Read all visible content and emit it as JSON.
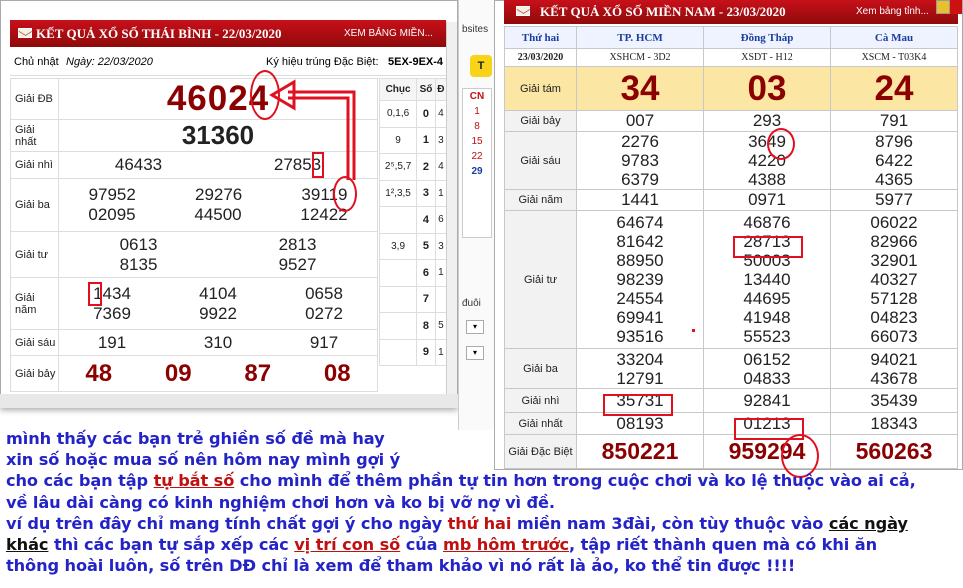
{
  "left_panel": {
    "title": "KẾT QUẢ XỔ SỐ THÁI BÌNH - 22/03/2020",
    "more_link": "XEM BẢNG MIỀN...",
    "day": "Chủ nhật",
    "date": "Ngày: 22/03/2020",
    "code_label": "Ký hiệu trúng Đặc Biệt:",
    "code_value": "5EX-9EX-4",
    "prizes": {
      "db": {
        "label": "Giải ĐB",
        "numbers": [
          "46024"
        ]
      },
      "nhat": {
        "label": "Giải nhất",
        "numbers": [
          "31360"
        ]
      },
      "nhi": {
        "label": "Giải nhì",
        "numbers": [
          "46433",
          "27853"
        ]
      },
      "ba": {
        "label": "Giải ba",
        "numbers": [
          "97952",
          "29276",
          "39119",
          "02095",
          "44500",
          "12422"
        ]
      },
      "tu": {
        "label": "Giải tư",
        "numbers": [
          "0613",
          "2813",
          "8135",
          "9527"
        ]
      },
      "nam": {
        "label": "Giải năm",
        "numbers": [
          "1434",
          "4104",
          "0658",
          "7369",
          "9922",
          "0272"
        ]
      },
      "sau": {
        "label": "Giải sáu",
        "numbers": [
          "191",
          "310",
          "917"
        ]
      },
      "bay": {
        "label": "Giải bảy",
        "numbers": [
          "48",
          "09",
          "87",
          "08"
        ]
      }
    },
    "side_table": {
      "headers": [
        "Chục",
        "Số",
        "Đ"
      ],
      "rows": [
        [
          "0,1,6",
          "0",
          "4"
        ],
        [
          "9",
          "1",
          "3"
        ],
        [
          "2⁵,5,7",
          "2",
          "4"
        ],
        [
          "1²,3,5",
          "3",
          "1"
        ],
        [
          "",
          "4",
          "6"
        ],
        [
          "3,9",
          "5",
          "3"
        ],
        [
          "",
          "6",
          "1"
        ],
        [
          "",
          "7",
          ""
        ],
        [
          "",
          "8",
          "5"
        ],
        [
          "",
          "9",
          "1"
        ]
      ]
    }
  },
  "middle": {
    "site_text": "bsites",
    "button_label": "T",
    "calendar": [
      "CN",
      "1",
      "8",
      "15",
      "22",
      "29"
    ],
    "duoi_label": "đuôi"
  },
  "right_panel": {
    "title": "KẾT QUẢ XỔ SỐ MIỀN NAM - 23/03/2020",
    "more_link": "Xem bảng tỉnh...",
    "day": "Thứ hai",
    "date": "23/03/2020",
    "provinces": [
      "TP. HCM",
      "Đồng Tháp",
      "Cà Mau"
    ],
    "codes": [
      "XSHCM - 3D2",
      "XSDT - H12",
      "XSCM - T03K4"
    ],
    "prizes": [
      {
        "label": "Giải tám",
        "values": [
          [
            "34"
          ],
          [
            "03"
          ],
          [
            "24"
          ]
        ]
      },
      {
        "label": "Giải bảy",
        "values": [
          [
            "007"
          ],
          [
            "293"
          ],
          [
            "791"
          ]
        ]
      },
      {
        "label": "Giải sáu",
        "values": [
          [
            "2276",
            "9783",
            "6379"
          ],
          [
            "3649",
            "4220",
            "4388"
          ],
          [
            "8796",
            "6422",
            "4365"
          ]
        ]
      },
      {
        "label": "Giải năm",
        "values": [
          [
            "1441"
          ],
          [
            "0971"
          ],
          [
            "5977"
          ]
        ]
      },
      {
        "label": "Giải tư",
        "values": [
          [
            "64674",
            "81642",
            "88950",
            "98239",
            "24554",
            "69941",
            "93516"
          ],
          [
            "46876",
            "28713",
            "50003",
            "13440",
            "44695",
            "41948",
            "55523"
          ],
          [
            "06022",
            "82966",
            "32901",
            "40327",
            "57128",
            "04823",
            "66073"
          ]
        ]
      },
      {
        "label": "Giải ba",
        "values": [
          [
            "33204",
            "12791"
          ],
          [
            "06152",
            "04833"
          ],
          [
            "94021",
            "43678"
          ]
        ]
      },
      {
        "label": "Giải nhì",
        "values": [
          [
            "35731"
          ],
          [
            "92841"
          ],
          [
            "35439"
          ]
        ]
      },
      {
        "label": "Giải nhất",
        "values": [
          [
            "08193"
          ],
          [
            "01213"
          ],
          [
            "18343"
          ]
        ]
      },
      {
        "label": "Giải Đặc Biệt",
        "values": [
          [
            "850221"
          ],
          [
            "959294"
          ],
          [
            "560263"
          ]
        ]
      }
    ]
  },
  "message": {
    "line1": "mình thấy các bạn trẻ ghiền số đề mà hay",
    "line2": "xin số hoặc mua số nên hôm nay mình gợi ý",
    "line3a": "cho các bạn tập ",
    "line3b": "tự bắt số",
    "line3c": " cho mình để thêm phần tự tin hơn trong cuộc chơi và ko lệ thuộc vào ai cả,",
    "line4": "về lâu dài càng có kinh nghiệm chơi hơn và ko bị vỡ nợ vì đề.",
    "line5a": "ví dụ trên đây chỉ mang tính chất gợi ý cho ngày ",
    "line5b": "thứ hai",
    "line5c": " miền nam 3đài, còn tùy thuộc vào ",
    "line5d": "các ngày",
    "line6a": "khác",
    "line6b": " thì các bạn tự sắp xếp các ",
    "line6c": "vị trí con số",
    "line6d": " của ",
    "line6e": "mb hôm trước",
    "line6f": ", tập riết thành quen mà có khi ăn",
    "line7": "thông hoài luôn, số trên DĐ chỉ là xem để tham khảo vì nó rất là ảo, ko thể tin được  !!!!"
  },
  "colors": {
    "header_red": "#b00c12",
    "prize_red": "#8b0000",
    "annotation_red": "#e01020",
    "text_blue": "#2323c8",
    "gold_row": "#fbe7a3"
  }
}
